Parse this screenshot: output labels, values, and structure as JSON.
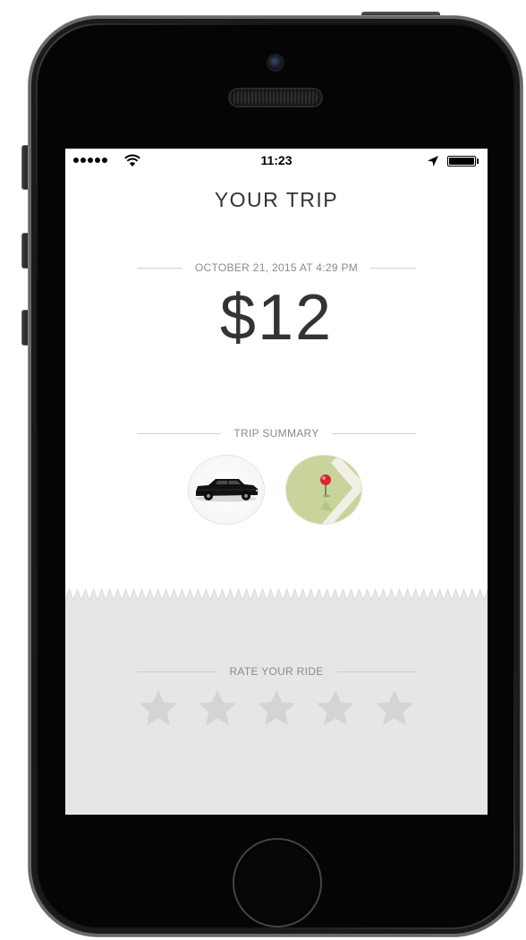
{
  "status_bar": {
    "time": "11:23",
    "signal_bars": 5
  },
  "trip": {
    "title": "YOUR TRIP",
    "date_label": "OCTOBER 21, 2015 AT 4:29 PM",
    "fare": "$12"
  },
  "summary": {
    "label": "TRIP SUMMARY",
    "icons": [
      "car-icon",
      "map-pin-icon"
    ]
  },
  "rating": {
    "label": "RATE YOUR RIDE",
    "max_stars": 5,
    "selected": 0
  },
  "colors": {
    "screen_bg": "#ffffff",
    "panel_bg": "#e6e6e6",
    "star": "#d4d4d4",
    "text_dark": "#333333",
    "text_muted": "#8a8a8a",
    "map_green": "#c8d49b",
    "pin_red": "#d9262c"
  }
}
